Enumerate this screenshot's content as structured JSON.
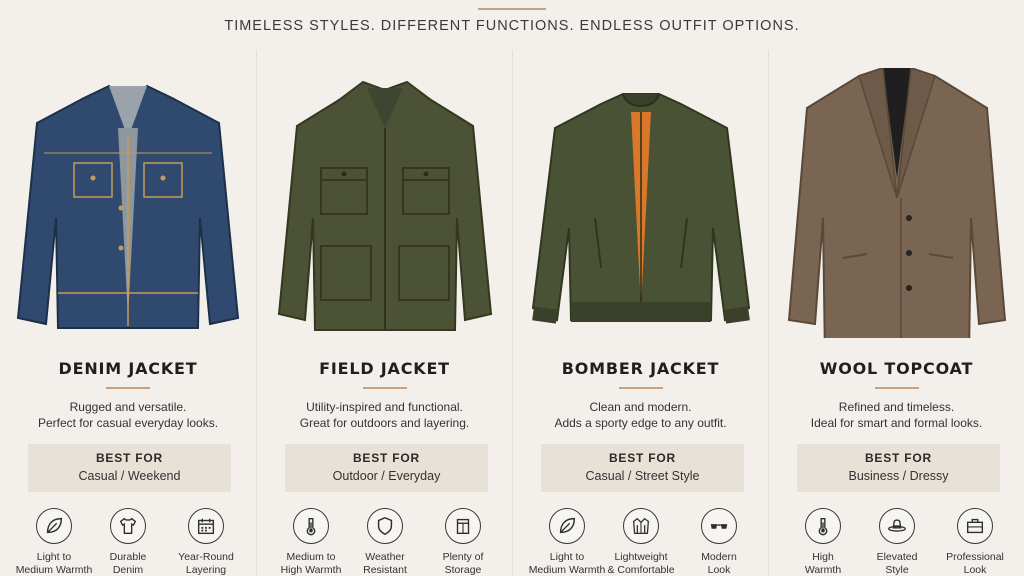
{
  "tagline": "TIMELESS STYLES. DIFFERENT FUNCTIONS. ENDLESS OUTFIT OPTIONS.",
  "jackets": [
    {
      "name": "DENIM JACKET",
      "desc1": "Rugged and versatile.",
      "desc2": "Perfect for casual everyday looks.",
      "best_label": "BEST FOR",
      "best_value": "Casual / Weekend",
      "garment_color": "#2f4a6e",
      "features": [
        {
          "icon": "leaf-icon",
          "l1": "Light to",
          "l2": "Medium Warmth"
        },
        {
          "icon": "tshirt-icon",
          "l1": "Durable",
          "l2": "Denim"
        },
        {
          "icon": "calendar-icon",
          "l1": "Year-Round",
          "l2": "Layering"
        }
      ]
    },
    {
      "name": "FIELD JACKET",
      "desc1": "Utility-inspired and functional.",
      "desc2": "Great for outdoors and layering.",
      "best_label": "BEST FOR",
      "best_value": "Outdoor / Everyday",
      "garment_color": "#4c5236",
      "features": [
        {
          "icon": "thermometer-icon",
          "l1": "Medium to",
          "l2": "High Warmth"
        },
        {
          "icon": "shield-icon",
          "l1": "Weather",
          "l2": "Resistant"
        },
        {
          "icon": "pocket-icon",
          "l1": "Plenty of",
          "l2": "Storage"
        }
      ]
    },
    {
      "name": "BOMBER JACKET",
      "desc1": "Clean and modern.",
      "desc2": "Adds a sporty edge to any outfit.",
      "best_label": "BEST FOR",
      "best_value": "Casual / Street Style",
      "garment_color": "#4a5236",
      "features": [
        {
          "icon": "leaf-icon",
          "l1": "Light to",
          "l2": "Medium Warmth"
        },
        {
          "icon": "jacket-icon",
          "l1": "Lightweight",
          "l2": "& Comfortable"
        },
        {
          "icon": "sunglasses-icon",
          "l1": "Modern",
          "l2": "Look"
        }
      ]
    },
    {
      "name": "WOOL TOPCOAT",
      "desc1": "Refined and timeless.",
      "desc2": "Ideal for smart and formal looks.",
      "best_label": "BEST FOR",
      "best_value": "Business / Dressy",
      "garment_color": "#7a6552",
      "features": [
        {
          "icon": "thermometer-icon",
          "l1": "High",
          "l2": "Warmth"
        },
        {
          "icon": "hat-icon",
          "l1": "Elevated",
          "l2": "Style"
        },
        {
          "icon": "briefcase-icon",
          "l1": "Professional",
          "l2": "Look"
        }
      ]
    }
  ]
}
